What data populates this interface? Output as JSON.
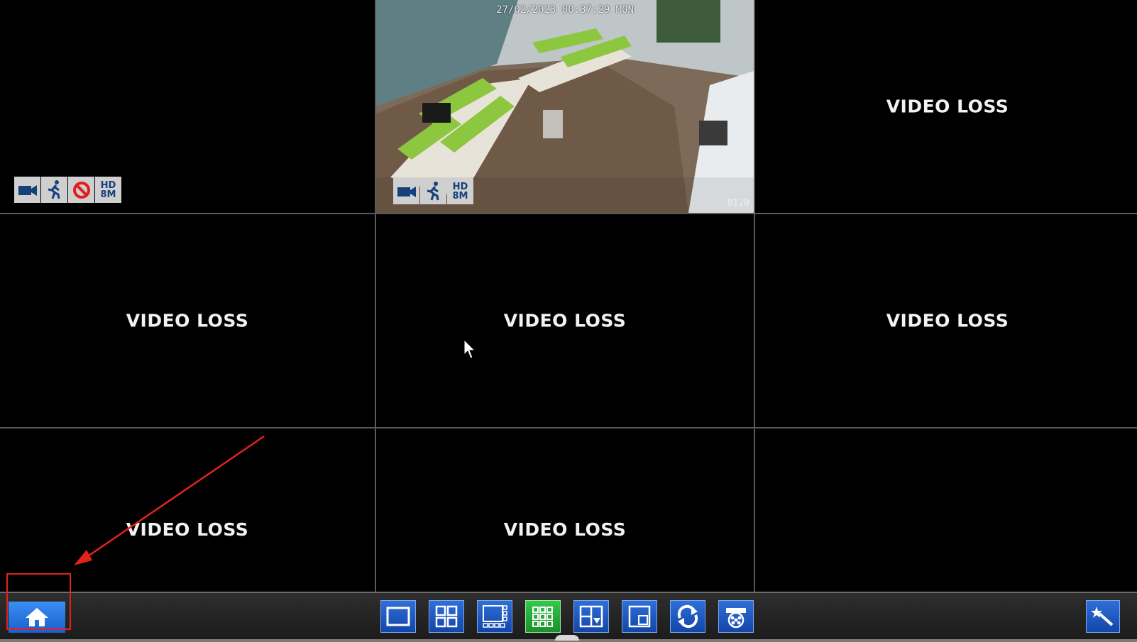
{
  "tiles": [
    {
      "id": 1,
      "status": "",
      "icons": [
        "video-camera-icon",
        "motion-icon",
        "no-record-icon",
        "hd-8m-badge"
      ]
    },
    {
      "id": 2,
      "status": "",
      "timestamp": "27/02/2023 00:37:29 MON",
      "channel_label": "8120",
      "icons": [
        "video-camera-icon",
        "motion-icon",
        "hd-8m-badge"
      ]
    },
    {
      "id": 3,
      "status": "VIDEO LOSS"
    },
    {
      "id": 4,
      "status": "VIDEO LOSS"
    },
    {
      "id": 5,
      "status": "VIDEO LOSS"
    },
    {
      "id": 6,
      "status": "VIDEO LOSS"
    },
    {
      "id": 7,
      "status": "VIDEO LOSS"
    },
    {
      "id": 8,
      "status": "VIDEO LOSS"
    },
    {
      "id": 9,
      "status": ""
    }
  ],
  "hd_badge": {
    "line1": "HD",
    "line2": "8M"
  },
  "toolbar": {
    "home_icon": "home-icon",
    "layout_buttons": [
      "single-view-icon",
      "quad-view-icon",
      "multi-view-icon",
      "nine-view-icon",
      "layout-select-icon",
      "pip-icon",
      "sequence-icon",
      "playback-icon"
    ],
    "active_layout": "nine-view-icon",
    "wizard_icon": "wizard-icon"
  },
  "colors": {
    "annotation": "#e3221c",
    "button_blue": "#1f5fd0",
    "button_active": "#2bb23e"
  }
}
